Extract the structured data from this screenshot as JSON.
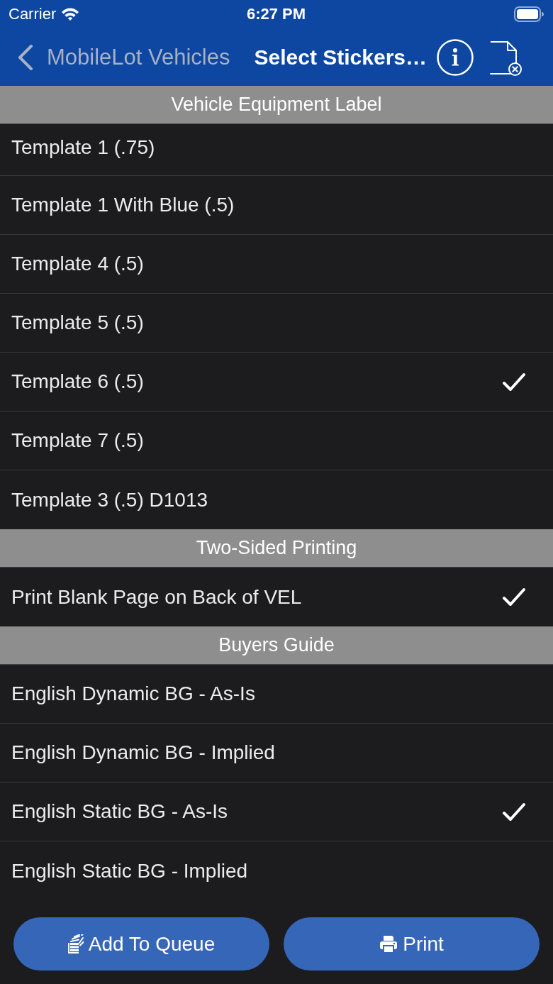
{
  "status_bar": {
    "carrier": "Carrier",
    "time": "6:27 PM"
  },
  "nav_bar": {
    "back_label": "MobileLot Vehicles",
    "title": "Select Stickers…"
  },
  "sections": [
    {
      "title": "Vehicle Equipment Label",
      "items": [
        {
          "label": "Template 1 (.75)",
          "selected": false
        },
        {
          "label": "Template 1 With Blue (.5)",
          "selected": false
        },
        {
          "label": "Template 4 (.5)",
          "selected": false
        },
        {
          "label": "Template 5 (.5)",
          "selected": false
        },
        {
          "label": "Template 6 (.5)",
          "selected": true
        },
        {
          "label": "Template 7 (.5)",
          "selected": false
        },
        {
          "label": "Template 3 (.5) D1013",
          "selected": false
        }
      ]
    },
    {
      "title": "Two-Sided Printing",
      "items": [
        {
          "label": "Print Blank Page on Back of VEL",
          "selected": true
        }
      ]
    },
    {
      "title": "Buyers Guide",
      "items": [
        {
          "label": "English Dynamic BG - As-Is",
          "selected": false
        },
        {
          "label": "English Dynamic BG - Implied",
          "selected": false
        },
        {
          "label": "English Static BG - As-Is",
          "selected": true
        },
        {
          "label": "English Static BG - Implied",
          "selected": false
        }
      ]
    }
  ],
  "buttons": [
    {
      "label": "Add To Queue",
      "kind": "queue"
    },
    {
      "label": "Print",
      "kind": "print"
    }
  ]
}
